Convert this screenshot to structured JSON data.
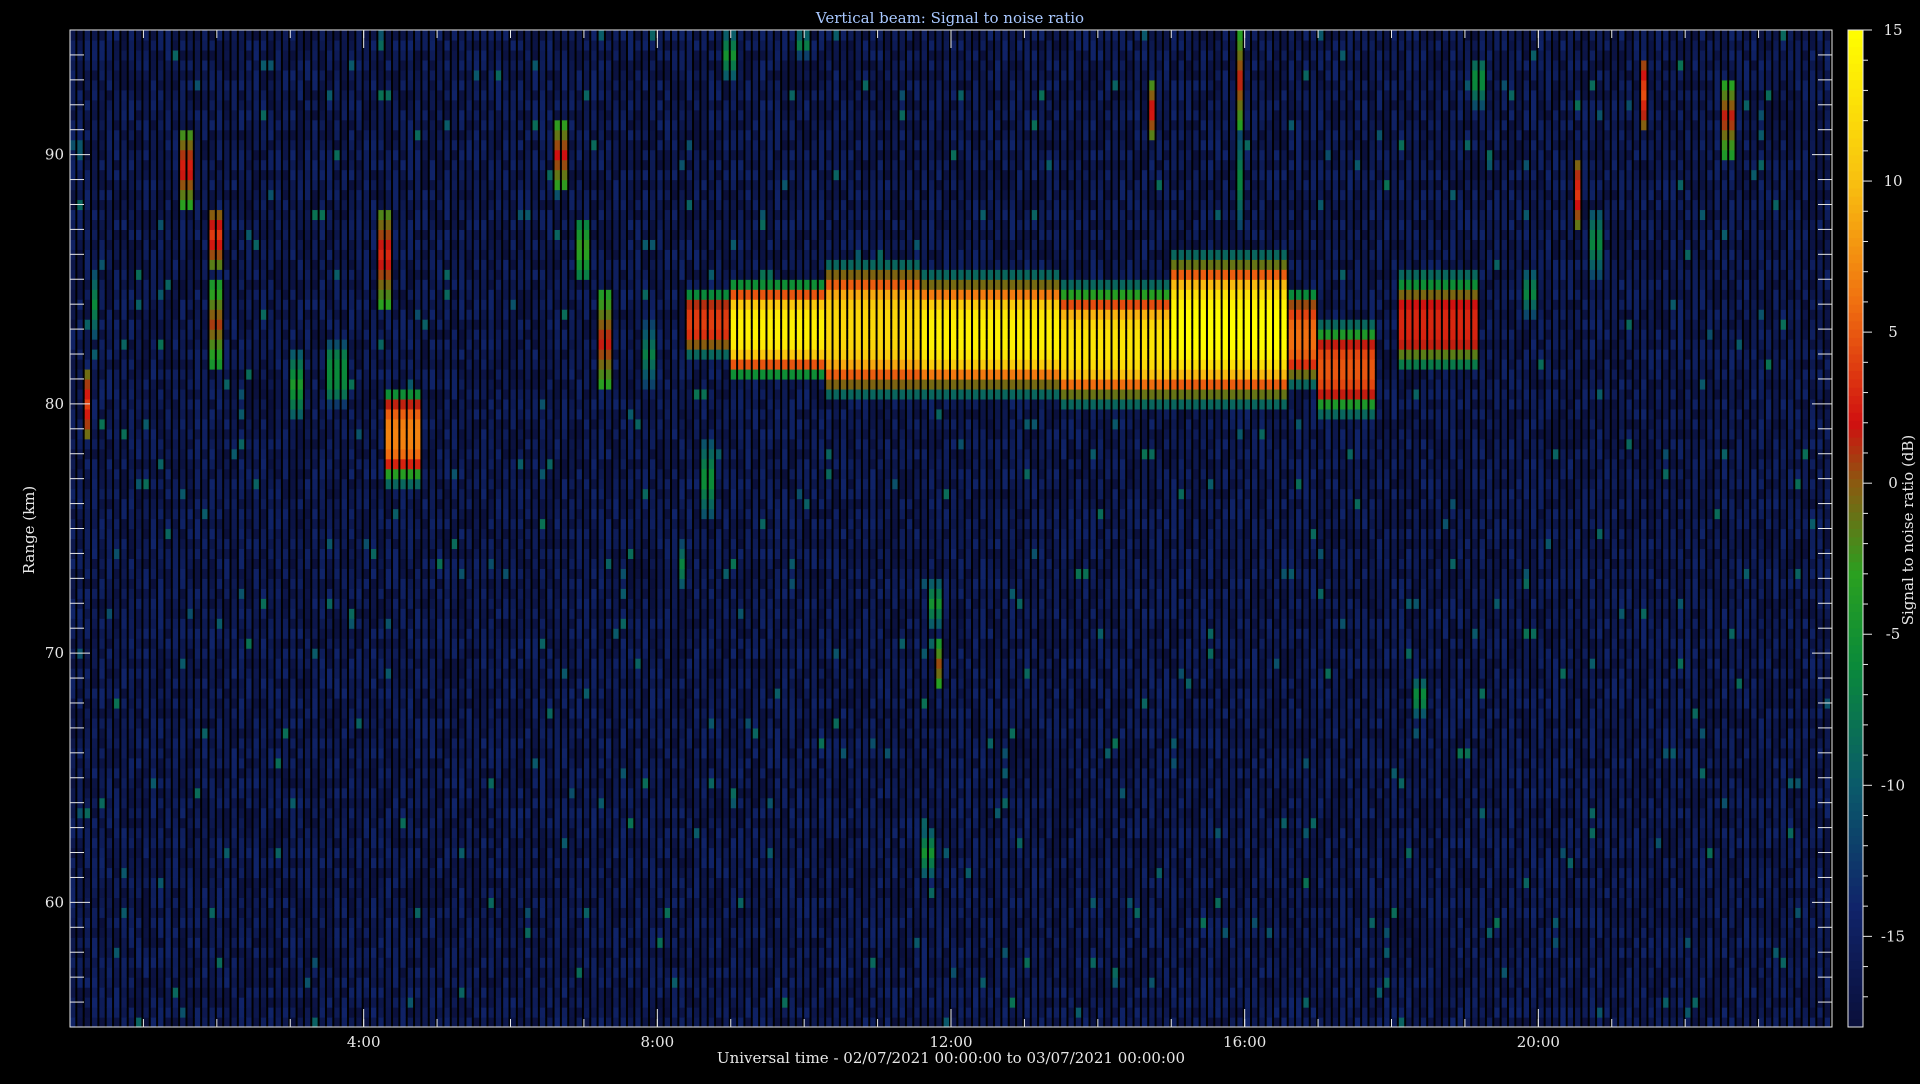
{
  "chart_data": {
    "type": "heatmap",
    "title": "Vertical beam: Signal to noise ratio",
    "xlabel": "Universal time - 02/07/2021 00:00:00 to 03/07/2021 00:00:00",
    "ylabel": "Range (km)",
    "colorbar_label": "Signal to noise ratio (dB)",
    "xlim": [
      0,
      24
    ],
    "ylim": [
      55,
      95
    ],
    "x_ticks": [
      {
        "value": 4,
        "label": "4:00"
      },
      {
        "value": 8,
        "label": "8:00"
      },
      {
        "value": 12,
        "label": "12:00"
      },
      {
        "value": 16,
        "label": "16:00"
      },
      {
        "value": 20,
        "label": "20:00"
      }
    ],
    "y_ticks": [
      {
        "value": 60,
        "label": "60"
      },
      {
        "value": 70,
        "label": "70"
      },
      {
        "value": 80,
        "label": "80"
      },
      {
        "value": 90,
        "label": "90"
      }
    ],
    "colorbar_range": [
      -18,
      15
    ],
    "colorbar_ticks": [
      {
        "value": 15,
        "label": "15"
      },
      {
        "value": 10,
        "label": "10"
      },
      {
        "value": 5,
        "label": "5"
      },
      {
        "value": 0,
        "label": "0"
      },
      {
        "value": -5,
        "label": "-5"
      },
      {
        "value": -10,
        "label": "-10"
      },
      {
        "value": -15,
        "label": "-15"
      }
    ],
    "colormap": [
      {
        "value": -18,
        "color": "#0a0f3a"
      },
      {
        "value": -14,
        "color": "#10246a"
      },
      {
        "value": -10,
        "color": "#0a5a6a"
      },
      {
        "value": -6,
        "color": "#0a8a3a"
      },
      {
        "value": -3,
        "color": "#2aa020"
      },
      {
        "value": 0,
        "color": "#8a5a10"
      },
      {
        "value": 2,
        "color": "#d01010"
      },
      {
        "value": 6,
        "color": "#f07010"
      },
      {
        "value": 10,
        "color": "#f8c010"
      },
      {
        "value": 15,
        "color": "#ffff00"
      }
    ],
    "background_db": -16,
    "main_layer": [
      {
        "t0": 8.4,
        "t1": 9.0,
        "lo": 82.0,
        "hi": 84.5,
        "peak": 4
      },
      {
        "t0": 9.0,
        "t1": 10.3,
        "lo": 81.2,
        "hi": 84.8,
        "peak": 14
      },
      {
        "t0": 10.3,
        "t1": 11.6,
        "lo": 80.5,
        "hi": 85.5,
        "peak": 12
      },
      {
        "t0": 11.6,
        "t1": 13.5,
        "lo": 80.6,
        "hi": 85.0,
        "peak": 14
      },
      {
        "t0": 13.5,
        "t1": 15.0,
        "lo": 80.2,
        "hi": 84.5,
        "peak": 13
      },
      {
        "t0": 15.0,
        "t1": 16.6,
        "lo": 80.2,
        "hi": 85.8,
        "peak": 15
      },
      {
        "t0": 16.6,
        "t1": 17.0,
        "lo": 80.8,
        "hi": 84.5,
        "peak": 6
      },
      {
        "t0": 17.0,
        "t1": 17.8,
        "lo": 79.8,
        "hi": 83.0,
        "peak": 5
      },
      {
        "t0": 18.1,
        "t1": 19.2,
        "lo": 81.5,
        "hi": 85.0,
        "peak": 3
      }
    ],
    "patches": [
      {
        "t0": 4.3,
        "t1": 4.85,
        "lo": 77.0,
        "hi": 80.5,
        "peak": 7
      },
      {
        "t0": 3.5,
        "t1": 3.8,
        "lo": 80.0,
        "hi": 82.5,
        "peak": -6
      }
    ],
    "streaks": [
      {
        "t": 0.25,
        "lo": 78.5,
        "hi": 81.5,
        "peak": 4
      },
      {
        "t": 0.35,
        "lo": 82.5,
        "hi": 85.5,
        "peak": -6
      },
      {
        "t": 1.6,
        "lo": 88.0,
        "hi": 91.0,
        "peak": 3
      },
      {
        "t": 2.0,
        "lo": 85.5,
        "hi": 88.0,
        "peak": 4
      },
      {
        "t": 2.0,
        "lo": 81.5,
        "hi": 85.0,
        "peak": 1
      },
      {
        "t": 3.1,
        "lo": 79.5,
        "hi": 82.0,
        "peak": -4
      },
      {
        "t": 4.3,
        "lo": 84.0,
        "hi": 88.0,
        "peak": 3
      },
      {
        "t": 6.7,
        "lo": 88.5,
        "hi": 91.5,
        "peak": 2
      },
      {
        "t": 7.0,
        "lo": 85.0,
        "hi": 87.5,
        "peak": -2
      },
      {
        "t": 7.3,
        "lo": 80.5,
        "hi": 84.5,
        "peak": 2
      },
      {
        "t": 7.9,
        "lo": 80.5,
        "hi": 83.5,
        "peak": -7
      },
      {
        "t": 8.7,
        "lo": 75.5,
        "hi": 78.5,
        "peak": -5
      },
      {
        "t": 8.35,
        "lo": 72.5,
        "hi": 74.5,
        "peak": -6
      },
      {
        "t": 9.0,
        "lo": 93.0,
        "hi": 95.0,
        "peak": -5
      },
      {
        "t": 10.0,
        "lo": 94.0,
        "hi": 95.0,
        "peak": -6
      },
      {
        "t": 11.8,
        "lo": 71.0,
        "hi": 73.0,
        "peak": -5
      },
      {
        "t": 11.85,
        "lo": 68.5,
        "hi": 70.5,
        "peak": 1
      },
      {
        "t": 11.7,
        "lo": 61.0,
        "hi": 63.0,
        "peak": -5
      },
      {
        "t": 14.75,
        "lo": 90.5,
        "hi": 93.0,
        "peak": 3
      },
      {
        "t": 15.95,
        "lo": 91.0,
        "hi": 95.0,
        "peak": 2
      },
      {
        "t": 15.95,
        "lo": 87.0,
        "hi": 91.0,
        "peak": -6
      },
      {
        "t": 18.4,
        "lo": 67.5,
        "hi": 69.0,
        "peak": -5
      },
      {
        "t": 19.2,
        "lo": 92.0,
        "hi": 94.0,
        "peak": -5
      },
      {
        "t": 19.9,
        "lo": 83.5,
        "hi": 85.5,
        "peak": -6
      },
      {
        "t": 20.55,
        "lo": 87.0,
        "hi": 90.0,
        "peak": 4
      },
      {
        "t": 20.8,
        "lo": 85.0,
        "hi": 88.0,
        "peak": -6
      },
      {
        "t": 21.45,
        "lo": 91.0,
        "hi": 94.0,
        "peak": 5
      },
      {
        "t": 22.6,
        "lo": 90.0,
        "hi": 93.0,
        "peak": 2
      }
    ]
  }
}
